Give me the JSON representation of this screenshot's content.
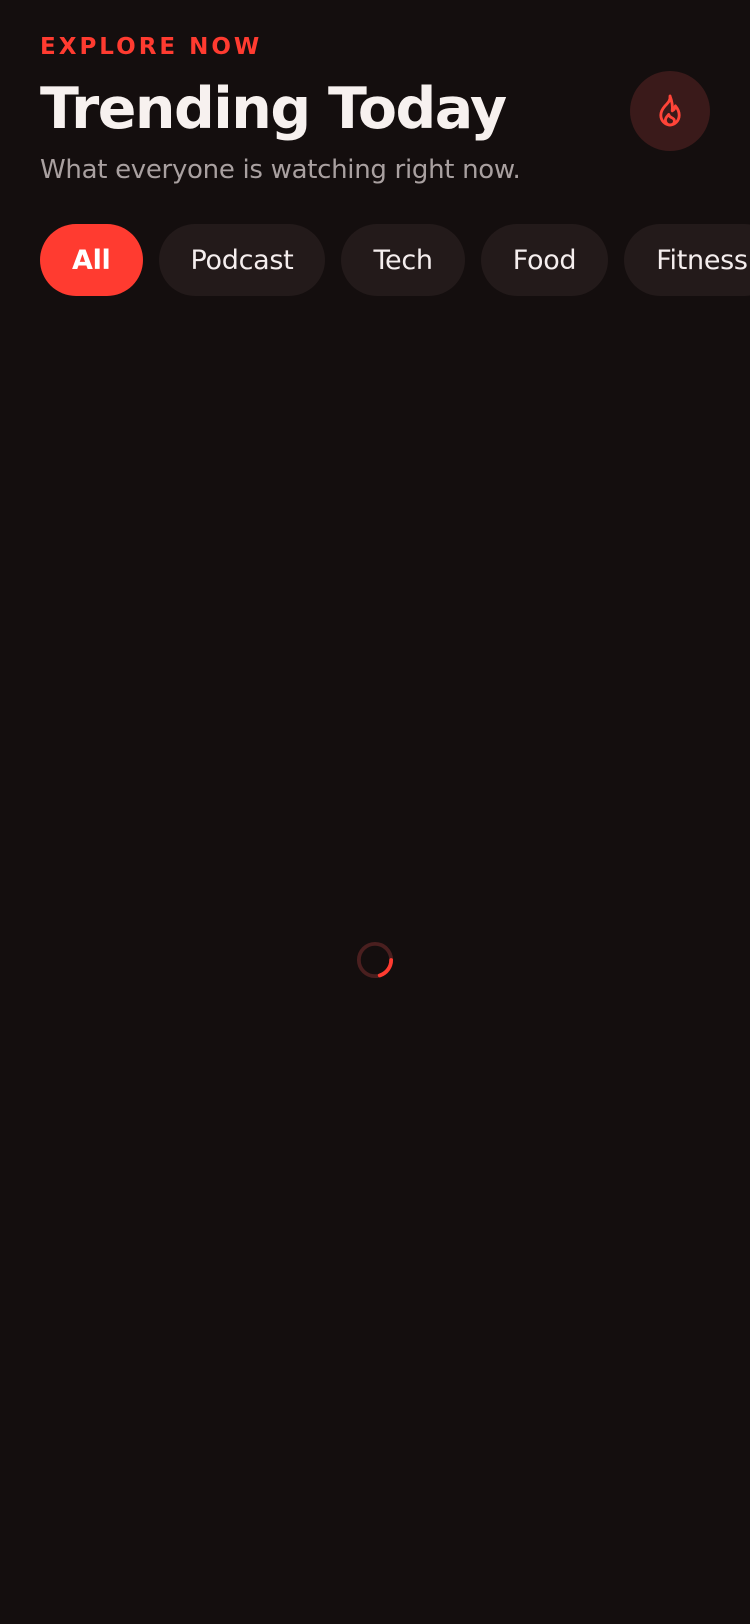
{
  "header": {
    "eyebrow": "EXPLORE NOW",
    "title": "Trending Today",
    "subtitle": "What everyone is watching right now."
  },
  "action_button": {
    "icon": "fire-icon"
  },
  "filters": {
    "items": [
      {
        "label": "All",
        "selected": true
      },
      {
        "label": "Podcast",
        "selected": false
      },
      {
        "label": "Tech",
        "selected": false
      },
      {
        "label": "Food",
        "selected": false
      },
      {
        "label": "Fitness",
        "selected": false
      }
    ]
  },
  "loading": {
    "icon": "loading-spinner-icon",
    "active": true
  },
  "colors": {
    "background": "#140e0e",
    "accent": "#ff3b30",
    "chip_background": "#231a1a",
    "fire_button_background": "#3a1a1a",
    "text_primary": "#f7f1ef",
    "text_secondary": "#a9a0a0"
  }
}
